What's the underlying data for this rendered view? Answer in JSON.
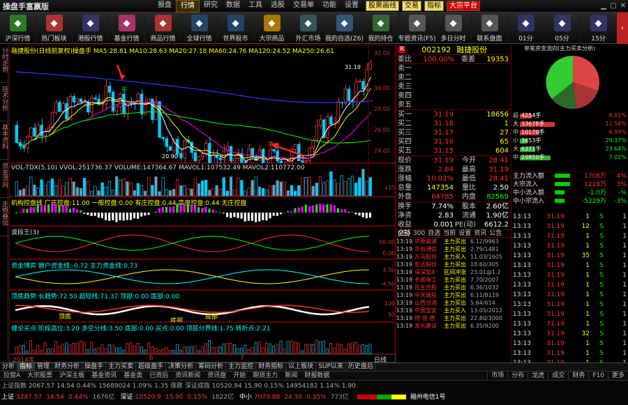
{
  "app": {
    "title": "操盘手富嬴版"
  },
  "menu": [
    {
      "label": "报盘"
    },
    {
      "label": "行情"
    },
    {
      "label": "研究"
    },
    {
      "label": "数据"
    },
    {
      "label": "工具"
    },
    {
      "label": "选股"
    },
    {
      "label": "交易单"
    },
    {
      "label": "功能"
    },
    {
      "label": "设置"
    }
  ],
  "badges": [
    {
      "label": "股票画线"
    },
    {
      "label": "交易"
    },
    {
      "label": "指标"
    },
    {
      "label": "大宗平台"
    }
  ],
  "toolbar": [
    {
      "label": "沪深行情",
      "icon": "chart-icon",
      "color": "#2a7a2a"
    },
    {
      "label": "热门板块",
      "icon": "fire-icon",
      "color": "#a33"
    },
    {
      "label": "港股行情",
      "icon": "hk-icon",
      "color": "#336"
    },
    {
      "label": "基金行情",
      "icon": "fund-icon",
      "color": "#a36"
    },
    {
      "label": "商品行情",
      "icon": "commodity-icon",
      "color": "#a33"
    },
    {
      "label": "全球行情",
      "icon": "globe-icon",
      "color": "#246"
    },
    {
      "label": "世界股市",
      "icon": "world-icon",
      "color": "#246"
    },
    {
      "label": "大宗商品",
      "icon": "gold-icon",
      "color": "#a70"
    },
    {
      "label": "外汇市场",
      "icon": "fx-icon",
      "color": "#355"
    },
    {
      "label": "我的自选(Z6)",
      "icon": "user-icon",
      "color": "#357"
    },
    {
      "label": "我的持仓",
      "icon": "hand-icon",
      "color": "#363"
    },
    {
      "label": "专题资讯(F5)",
      "icon": "news-icon",
      "color": "#555"
    },
    {
      "label": "多日分时",
      "icon": "clock-icon",
      "color": "#555"
    },
    {
      "label": "联系盘面",
      "icon": "grid-icon",
      "color": "#555"
    },
    {
      "label": "01分",
      "icon": "clock01-icon",
      "color": "#336"
    },
    {
      "label": "05分",
      "icon": "clock05-icon",
      "color": "#336"
    },
    {
      "label": "15分",
      "icon": "clock15-icon",
      "color": "#336"
    }
  ],
  "lefttabs": [
    {
      "label": "分时走势"
    },
    {
      "label": "技术分析"
    },
    {
      "label": "基本资料"
    },
    {
      "label": "资金流向"
    },
    {
      "label": "走势叠加"
    }
  ],
  "main": {
    "header": "融捷股份(日线前复权)操盘手 MA5:28.81 MA10:28.63 MA20:27.18 MA60:24.76 MA120:24.52 MA250:26.61",
    "price_axis": [
      "32.00",
      "30.00",
      "28.00",
      "26.00",
      "24.00",
      "22.00"
    ],
    "low_label": "20.90",
    "high_label": "31.19",
    "buy_label": "买",
    "sell_label": "卖",
    "vol_header": "VOL-TDX(5,10) VVOL:251736.37 VOLUME:147364.67 MAVOL1:107532.49 MAVOL2:110772.00",
    "vol_axis": "x10",
    "ind1_header": "机构控盘线 广庄控盘:11.00 一般控盘:0.00 有庄控盘:0.44 高度控盘:0.44 无庄控盘",
    "ind2_header": "波段王(3)",
    "ind2_axis": [
      "50.00",
      "0.00"
    ],
    "ind3_header": "资金博弈 散户资金线:-0.72 主力资金线:0.73",
    "ind3_axis": [
      "4.50",
      "-4.50"
    ],
    "ind4_header": "顶底趋势 长趋势:72.50 超短线:71.37 顶部:0.00 底部:0.00",
    "ind4_axis": [
      "100",
      "50"
    ],
    "ind4_tags": [
      "顶底",
      "底部",
      "底部"
    ],
    "ind5_header": "缠论买点 阶段高位:3.20 多空分线:3.50 底部:0.00 买点:0.00 顶部分界线:1.75 转折点:2.21",
    "date_label": "2014年",
    "date_ticks": [
      "6",
      "7"
    ],
    "scale_btn": "日线"
  },
  "quote": {
    "code": "002192",
    "name": "融捷股份",
    "wei_bi_label": "委比",
    "wei_bi": "100.00%",
    "wei_cha_label": "委差",
    "wei_cha": "19353",
    "sells": [
      {
        "label": "卖五",
        "price": "",
        "vol": ""
      },
      {
        "label": "卖四",
        "price": "",
        "vol": ""
      },
      {
        "label": "卖三",
        "price": "",
        "vol": ""
      },
      {
        "label": "卖二",
        "price": "",
        "vol": ""
      },
      {
        "label": "卖一",
        "price": "",
        "vol": ""
      }
    ],
    "buys": [
      {
        "label": "买一",
        "price": "31.19",
        "vol": "18656"
      },
      {
        "label": "买二",
        "price": "31.18",
        "vol": "1"
      },
      {
        "label": "买三",
        "price": "31.17",
        "vol": "27"
      },
      {
        "label": "买四",
        "price": "31.16",
        "vol": "65"
      },
      {
        "label": "买五",
        "price": "31.15",
        "vol": "604"
      }
    ],
    "stats": [
      {
        "l1": "现价",
        "v1": "31.19",
        "l2": "今开",
        "v2": "28.41"
      },
      {
        "l1": "涨跌",
        "v1": "2.84",
        "l2": "最高",
        "v2": "31.19"
      },
      {
        "l1": "涨幅",
        "v1": "10.02%",
        "l2": "最低",
        "v2": "28.41"
      },
      {
        "l1": "总量",
        "v1": "147354",
        "l2": "量比",
        "v2": "2.50"
      },
      {
        "l1": "外盘",
        "v1": "64785",
        "l2": "内盘",
        "v2": "82569"
      },
      {
        "l1": "换手",
        "v1": "7.74%",
        "l2": "股本",
        "v2": "2.60亿"
      },
      {
        "l1": "净资",
        "v1": "2.83",
        "l2": "流通",
        "v2": "1.90亿"
      },
      {
        "l1": "收益(三)",
        "v1": "0.001",
        "l2": "PE(动)",
        "v2": "6612.2"
      }
    ],
    "tabs": [
      "全部",
      "300",
      "自选",
      "当前",
      "设置",
      "资讯",
      "公告"
    ]
  },
  "news": [
    {
      "t": "13:19",
      "n": "中原高速",
      "a": "主力买出",
      "v": "6.12/9963"
    },
    {
      "t": "13:19",
      "n": "华创通信",
      "a": "主力买出",
      "v": "2.79/1481"
    },
    {
      "t": "13:19",
      "n": "万马股份",
      "a": "主力买入",
      "v": "11.03/1605"
    },
    {
      "t": "13:19",
      "n": "宏达股份",
      "a": "主力买出",
      "v": "10.60/305"
    },
    {
      "t": "13:19",
      "n": "深深宝A",
      "a": "区间冲涨",
      "v": "23.01@1.2"
    },
    {
      "t": "13:19",
      "n": "长城电工",
      "a": "主力买出",
      "v": "7.70/2007"
    },
    {
      "t": "13:19",
      "n": "民生控股",
      "a": "主力买出",
      "v": "6.36/1032"
    },
    {
      "t": "13:19",
      "n": "中天城投",
      "a": "主力买出",
      "v": "6.11/8119"
    },
    {
      "t": "13:19",
      "n": "山西汾酒",
      "a": "主力买出",
      "v": "5.64/614"
    },
    {
      "t": "13:19",
      "n": "中国宝安",
      "a": "主力买入",
      "v": "13.05/2012"
    },
    {
      "t": "13:19",
      "n": "特 锐 德",
      "a": "主力买出",
      "v": "22.80/3000"
    },
    {
      "t": "13:19",
      "n": "龙元建设",
      "a": "主力买出",
      "v": "6.35/9200"
    }
  ],
  "flow": {
    "header": "单笔资金流向(主力买卖分析)",
    "bars": [
      {
        "label": "超大",
        "value": "4254手",
        "pct": "6.01%"
      },
      {
        "label": "大",
        "value": "33678手",
        "pct": "11.58%"
      },
      {
        "label": "中",
        "value": "10170手",
        "pct": "6.99%"
      },
      {
        "label": "小",
        "value": "3653手",
        "pct": "29.37%"
      },
      {
        "label": "大",
        "value": "6371手",
        "pct": "23.64%"
      },
      {
        "label": "中",
        "value": "20850手",
        "pct": "7.02%"
      }
    ],
    "net": [
      {
        "label": "主力流入额",
        "v": "1708万",
        "p": "4%"
      },
      {
        "label": "大宗流入",
        "v": "1218万",
        "p": "3%"
      },
      {
        "label": "中小流入额",
        "v": "-1.0万",
        "p": "-%"
      },
      {
        "label": "中小宗流入",
        "v": "-5229万",
        "p": "-3%"
      }
    ]
  },
  "ticks": [
    {
      "t": "13:13",
      "p": "31.19",
      "v": "1",
      "f": "S",
      "n": "1"
    },
    {
      "t": "13:13",
      "p": "31.19",
      "v": "12",
      "f": "S",
      "n": "1"
    },
    {
      "t": "13:13",
      "p": "31.19",
      "v": "1",
      "f": "S",
      "n": "1"
    },
    {
      "t": "13:13",
      "p": "31.19",
      "v": "1",
      "f": "S",
      "n": "1"
    },
    {
      "t": "13:13",
      "p": "31.19",
      "v": "35",
      "f": "S",
      "n": "1"
    },
    {
      "t": "13:13",
      "p": "31.19",
      "v": "1",
      "f": "S",
      "n": "1"
    },
    {
      "t": "13:13",
      "p": "31.19",
      "v": "1",
      "f": "S",
      "n": "1"
    },
    {
      "t": "13:13",
      "p": "31.19",
      "v": "1",
      "f": "S",
      "n": "1"
    },
    {
      "t": "13:13",
      "p": "31.19",
      "v": "1",
      "f": "S",
      "n": "1"
    },
    {
      "t": "13:13",
      "p": "31.19",
      "v": "1",
      "f": "S",
      "n": "1"
    },
    {
      "t": "13:13",
      "p": "31.19",
      "v": "1",
      "f": "S",
      "n": "1"
    },
    {
      "t": "13:13",
      "p": "31.19",
      "v": "1",
      "f": "S",
      "n": "1"
    },
    {
      "t": "13:13",
      "p": "31.19",
      "v": "32",
      "f": "S",
      "n": "1"
    },
    {
      "t": "13:13",
      "p": "31.19",
      "v": "1",
      "f": "S",
      "n": "1"
    },
    {
      "t": "13:13",
      "p": "31.19",
      "v": "1",
      "f": "S",
      "n": "1"
    },
    {
      "t": "13:13",
      "p": "31.19",
      "v": "1",
      "f": "S",
      "n": "1"
    }
  ],
  "bottom_tabs": [
    "分析",
    "指标",
    "管理",
    "财务分析",
    "操盘手",
    "主力买卖",
    "超级盘手",
    "决策分析",
    "筹码分析",
    "主力监控",
    "财务指标",
    "以上板块",
    "SUP以来",
    "历史盘后"
  ],
  "tabs2": [
    "拉窗A",
    "大宗股票",
    "沪深主板",
    "基金资讯",
    "基金类",
    "已资后",
    "资讯新闻",
    "资讯盘",
    "开始",
    "期货主力",
    "新闻",
    "财报数据"
  ],
  "tabs2_right": [
    "市场",
    "分布",
    "龙虎",
    "成交",
    "财务",
    "F10",
    "更多"
  ],
  "status": {
    "row1": "上证指数 2067.57 14.54 0.44% 15689024 1.09% 1.35 涨跌 深证成指 10520.94 15.90 0.15% 14954182 1.14% 1.90",
    "sh_label": "上证",
    "sh": "3287.57",
    "sh_ch": "14.54",
    "sh_pct": "0.44%",
    "sh_vol": "1676亿",
    "sz_label": "深证",
    "sz": "10520.9",
    "sz_ch": "15.90",
    "sz_pct": "0.15%",
    "sz_vol": "1822亿",
    "zx_label": "中小",
    "zx": "7079.88",
    "zx_ch": "24.30",
    "zx_pct": "0.35%",
    "zx_vol": "773亿",
    "server": "福州电信1号"
  }
}
